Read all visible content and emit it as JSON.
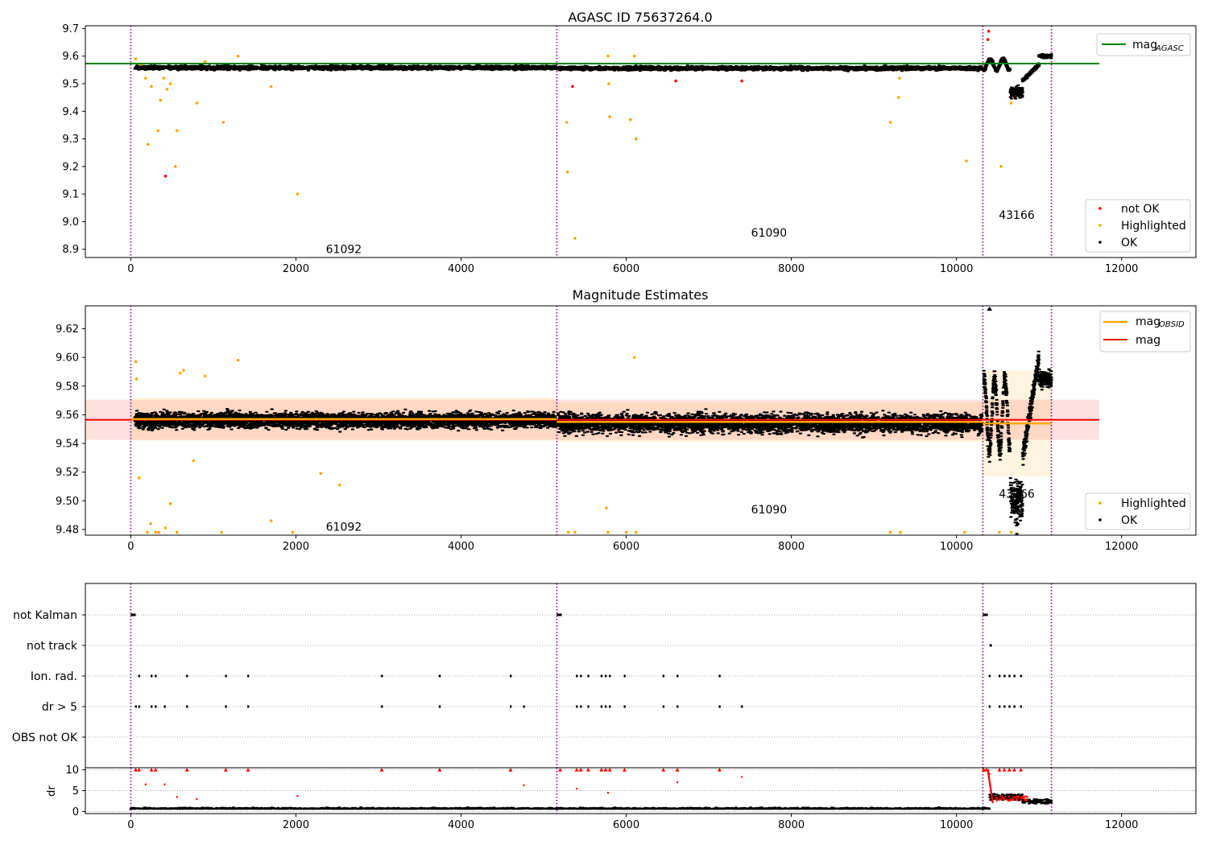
{
  "chart_data": [
    {
      "type": "scatter",
      "title": "AGASC ID 75637264.0",
      "xlim": [
        -550,
        12900
      ],
      "ylim": [
        8.87,
        9.71
      ],
      "x_ticks": [
        "0",
        "2000",
        "4000",
        "6000",
        "8000",
        "10000",
        "12000"
      ],
      "x_tick_values": [
        0,
        2000,
        4000,
        6000,
        8000,
        10000,
        12000
      ],
      "y_ticks": [
        "8.9",
        "9.0",
        "9.1",
        "9.2",
        "9.3",
        "9.4",
        "9.5",
        "9.6",
        "9.7"
      ],
      "y_tick_values": [
        8.9,
        9.0,
        9.1,
        9.2,
        9.3,
        9.4,
        9.5,
        9.6,
        9.7
      ],
      "legend_top": {
        "entries": [
          {
            "label": "mag",
            "sub": "AGASC",
            "color": "#008000"
          }
        ],
        "placement": "top-right"
      },
      "legend_bottom": {
        "entries": [
          {
            "label": "not OK",
            "color": "#ff0000"
          },
          {
            "label": "Highlighted",
            "color": "#ffa500"
          },
          {
            "label": "OK",
            "color": "#000000"
          }
        ],
        "placement": "bottom-right"
      },
      "hline": {
        "y": 9.573,
        "x_range": [
          -550,
          11730
        ],
        "color": "#008000"
      },
      "obsid_boundaries": [
        0,
        5160,
        10320,
        11150
      ],
      "obsid_labels": [
        {
          "text": "61092",
          "x": 2580,
          "y": 8.9
        },
        {
          "text": "61090",
          "x": 7730,
          "y": 8.96
        },
        {
          "text": "43166",
          "x": 10730,
          "y": 9.025
        }
      ],
      "series": [
        {
          "name": "OK",
          "color": "#000000",
          "segments": [
            {
              "x": [
                50,
                5150
              ],
              "center": 9.558,
              "spread": 0.012
            },
            {
              "x": [
                5170,
                10310
              ],
              "center": 9.556,
              "spread": 0.012
            }
          ]
        },
        {
          "name": "Highlighted",
          "color": "#ffa500",
          "points": [
            [
              60,
              9.59
            ],
            [
              120,
              9.57
            ],
            [
              180,
              9.52
            ],
            [
              210,
              9.28
            ],
            [
              250,
              9.49
            ],
            [
              330,
              9.33
            ],
            [
              360,
              9.44
            ],
            [
              400,
              9.52
            ],
            [
              440,
              9.48
            ],
            [
              480,
              9.5
            ],
            [
              540,
              9.2
            ],
            [
              560,
              9.33
            ],
            [
              800,
              9.43
            ],
            [
              900,
              9.58
            ],
            [
              1120,
              9.36
            ],
            [
              1300,
              9.6
            ],
            [
              1700,
              9.49
            ],
            [
              2020,
              9.1
            ],
            [
              5280,
              9.36
            ],
            [
              5290,
              9.18
            ],
            [
              5380,
              8.94
            ],
            [
              5780,
              9.6
            ],
            [
              5790,
              9.5
            ],
            [
              5800,
              9.38
            ],
            [
              6050,
              9.37
            ],
            [
              6100,
              9.6
            ],
            [
              6120,
              9.3
            ],
            [
              9200,
              9.36
            ],
            [
              9300,
              9.45
            ],
            [
              9310,
              9.52
            ],
            [
              10120,
              9.22
            ],
            [
              10540,
              9.2
            ],
            [
              10660,
              9.43
            ]
          ]
        },
        {
          "name": "not OK",
          "color": "#ff0000",
          "points": [
            [
              420,
              9.165
            ],
            [
              5350,
              9.49
            ],
            [
              6600,
              9.51
            ],
            [
              7400,
              9.51
            ],
            [
              10390,
              9.69
            ],
            [
              10380,
              9.66
            ]
          ]
        }
      ]
    },
    {
      "type": "scatter",
      "title": "Magnitude Estimates",
      "xlim": [
        -550,
        12900
      ],
      "ylim": [
        9.476,
        9.636
      ],
      "x_ticks": [
        "0",
        "2000",
        "4000",
        "6000",
        "8000",
        "10000",
        "12000"
      ],
      "x_tick_values": [
        0,
        2000,
        4000,
        6000,
        8000,
        10000,
        12000
      ],
      "y_ticks": [
        "9.48",
        "9.50",
        "9.52",
        "9.54",
        "9.56",
        "9.58",
        "9.60",
        "9.62"
      ],
      "y_tick_values": [
        9.48,
        9.5,
        9.52,
        9.54,
        9.56,
        9.58,
        9.6,
        9.62
      ],
      "legend_top": {
        "entries": [
          {
            "label": "mag",
            "sub": "OBSID",
            "color": "#ffa500"
          },
          {
            "label": "mag",
            "sub": "",
            "color": "#ff0000"
          }
        ],
        "placement": "top-right"
      },
      "legend_bottom": {
        "entries": [
          {
            "label": "Highlighted",
            "color": "#ffa500"
          },
          {
            "label": "OK",
            "color": "#000000"
          }
        ],
        "placement": "bottom-right"
      },
      "mag_band": {
        "y": [
          9.5425,
          9.5705
        ],
        "x_range": [
          -550,
          11730
        ],
        "line": 9.5565
      },
      "obsid_lines": [
        {
          "x": [
            0,
            5160
          ],
          "y": 9.557,
          "band": [
            9.542,
            9.572
          ]
        },
        {
          "x": [
            5160,
            10320
          ],
          "y": 9.555,
          "band": [
            9.541,
            9.569
          ]
        },
        {
          "x": [
            10320,
            11150
          ],
          "y": 9.554,
          "band": [
            9.517,
            9.591
          ]
        }
      ],
      "obsid_boundaries": [
        0,
        5160,
        10320,
        11150
      ],
      "obsid_labels": [
        {
          "text": "61092",
          "x": 2580,
          "y": 9.482
        },
        {
          "text": "61090",
          "x": 7730,
          "y": 9.494
        },
        {
          "text": "43166",
          "x": 10730,
          "y": 9.505
        }
      ],
      "series": [
        {
          "name": "OK",
          "color": "#000000",
          "segments": [
            {
              "x": [
                50,
                5150
              ],
              "center": 9.556,
              "spread": 0.009
            },
            {
              "x": [
                5170,
                10310
              ],
              "center": 9.554,
              "spread": 0.011
            }
          ]
        },
        {
          "name": "Highlighted",
          "color": "#ffa500",
          "points": [
            [
              60,
              9.597
            ],
            [
              70,
              9.585
            ],
            [
              100,
              9.516
            ],
            [
              200,
              9.478
            ],
            [
              240,
              9.484
            ],
            [
              300,
              9.478
            ],
            [
              340,
              9.478
            ],
            [
              420,
              9.481
            ],
            [
              480,
              9.498
            ],
            [
              560,
              9.478
            ],
            [
              600,
              9.589
            ],
            [
              640,
              9.591
            ],
            [
              760,
              9.528
            ],
            [
              900,
              9.587
            ],
            [
              1100,
              9.478
            ],
            [
              1300,
              9.598
            ],
            [
              1700,
              9.486
            ],
            [
              1960,
              9.478
            ],
            [
              2300,
              9.519
            ],
            [
              2530,
              9.511
            ],
            [
              5300,
              9.478
            ],
            [
              5380,
              9.478
            ],
            [
              5760,
              9.495
            ],
            [
              5780,
              9.478
            ],
            [
              6000,
              9.478
            ],
            [
              6100,
              9.6
            ],
            [
              6120,
              9.478
            ],
            [
              9200,
              9.478
            ],
            [
              9320,
              9.478
            ],
            [
              10100,
              9.478
            ],
            [
              10520,
              9.478
            ],
            [
              10660,
              9.478
            ]
          ]
        }
      ]
    },
    {
      "type": "scatter",
      "title": "",
      "xlim": [
        -550,
        12900
      ],
      "categories": [
        "not Kalman",
        "not track",
        "Ion. rad.",
        "dr > 5",
        "OBS not OK"
      ],
      "obsid_boundaries": [
        0,
        5160,
        10320,
        11150
      ],
      "flags": {
        "not Kalman": [
          [
            0,
            60
          ],
          [
            5160,
            5220
          ],
          [
            10320,
            10380
          ]
        ],
        "not track": [
          [
            10400,
            10420
          ]
        ],
        "Ion. rad.": [
          100,
          250,
          300,
          680,
          1150,
          1420,
          3040,
          3740,
          4600,
          5400,
          5450,
          5540,
          5700,
          5750,
          5800,
          5980,
          6450,
          6620,
          7130,
          10400,
          10520,
          10580,
          10640,
          10700,
          10780
        ],
        "dr > 5": [
          60,
          100,
          250,
          300,
          410,
          680,
          1150,
          1420,
          3040,
          3740,
          4600,
          4760,
          5400,
          5450,
          5540,
          5700,
          5750,
          5800,
          5980,
          6450,
          6620,
          7130,
          7400,
          10400,
          10520,
          10580,
          10640,
          10700,
          10780
        ],
        "OBS not OK": []
      }
    },
    {
      "type": "scatter",
      "title": "",
      "xlim": [
        -550,
        12900
      ],
      "ylim": [
        -0.5,
        10.5
      ],
      "ylabel": "dr",
      "x_ticks": [
        "0",
        "2000",
        "4000",
        "6000",
        "8000",
        "10000",
        "12000"
      ],
      "x_tick_values": [
        0,
        2000,
        4000,
        6000,
        8000,
        10000,
        12000
      ],
      "y_ticks": [
        "0",
        "5",
        "10"
      ],
      "y_tick_values": [
        0,
        5,
        10
      ],
      "obsid_boundaries": [
        0,
        5160,
        10320,
        11150
      ],
      "series": [
        {
          "name": "dr",
          "color": "#000000",
          "baseline": 0.6
        },
        {
          "name": "dr > 5",
          "color": "#ff0000",
          "points": [
            [
              60,
              10
            ],
            [
              100,
              10
            ],
            [
              250,
              10
            ],
            [
              300,
              10
            ],
            [
              180,
              6.5
            ],
            [
              410,
              6.5
            ],
            [
              560,
              3.5
            ],
            [
              680,
              10
            ],
            [
              800,
              3
            ],
            [
              1150,
              10
            ],
            [
              1420,
              10
            ],
            [
              2020,
              3.7
            ],
            [
              3040,
              10
            ],
            [
              3740,
              10
            ],
            [
              4600,
              10
            ],
            [
              4760,
              6.3
            ],
            [
              5200,
              10
            ],
            [
              5400,
              10
            ],
            [
              5450,
              10
            ],
            [
              5400,
              5.5
            ],
            [
              5540,
              10
            ],
            [
              5700,
              10
            ],
            [
              5750,
              10
            ],
            [
              5800,
              10
            ],
            [
              5780,
              4.5
            ],
            [
              5980,
              10
            ],
            [
              6450,
              10
            ],
            [
              6620,
              10
            ],
            [
              6620,
              7
            ],
            [
              7130,
              10
            ],
            [
              7400,
              8.3
            ],
            [
              10330,
              10
            ],
            [
              10360,
              10
            ],
            [
              10400,
              9
            ],
            [
              10520,
              10
            ],
            [
              10580,
              10
            ],
            [
              10640,
              10
            ],
            [
              10700,
              10
            ],
            [
              10780,
              10
            ]
          ]
        }
      ]
    }
  ]
}
